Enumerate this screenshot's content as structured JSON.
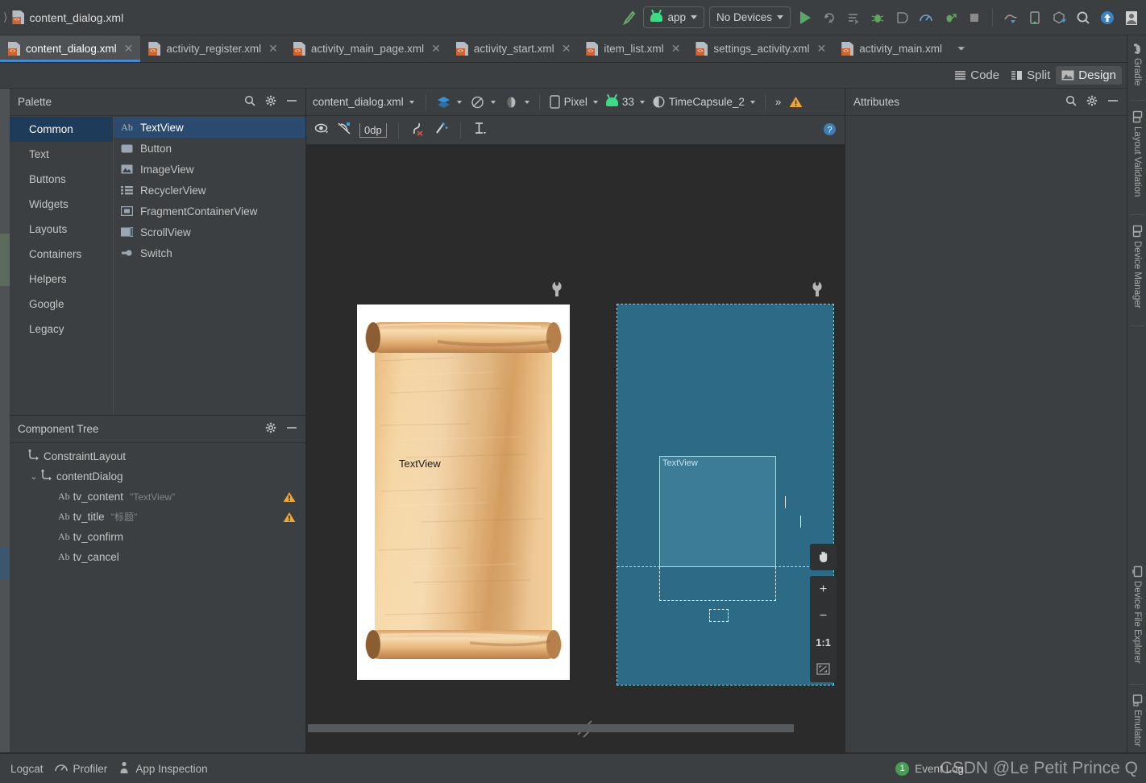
{
  "breadcrumb": {
    "file": "content_dialog.xml"
  },
  "toolbar": {
    "module_selector": "app",
    "device_selector": "No Devices",
    "icons": [
      "hammer-icon",
      "run-icon",
      "rerun-icon",
      "apply-changes-icon",
      "debug-icon",
      "attach-debugger-icon",
      "profile-icon",
      "run-coverage-icon",
      "stop-icon",
      "device-mirroring-icon",
      "device-manager-icon",
      "sdk-manager-icon",
      "search-icon",
      "update-icon",
      "avatar-icon"
    ]
  },
  "tabs": [
    {
      "label": "content_dialog.xml",
      "active": true
    },
    {
      "label": "activity_register.xml",
      "active": false
    },
    {
      "label": "activity_main_page.xml",
      "active": false
    },
    {
      "label": "activity_start.xml",
      "active": false
    },
    {
      "label": "item_list.xml",
      "active": false
    },
    {
      "label": "settings_activity.xml",
      "active": false
    },
    {
      "label": "activity_main.xml",
      "active": false
    }
  ],
  "editor_modes": [
    {
      "label": "Code",
      "icon": "code-lines-icon",
      "active": false
    },
    {
      "label": "Split",
      "icon": "split-view-icon",
      "active": false
    },
    {
      "label": "Design",
      "icon": "design-view-icon",
      "active": true
    }
  ],
  "palette": {
    "title": "Palette",
    "categories": [
      {
        "label": "Common",
        "selected": true
      },
      {
        "label": "Text",
        "selected": false
      },
      {
        "label": "Buttons",
        "selected": false
      },
      {
        "label": "Widgets",
        "selected": false
      },
      {
        "label": "Layouts",
        "selected": false
      },
      {
        "label": "Containers",
        "selected": false
      },
      {
        "label": "Helpers",
        "selected": false
      },
      {
        "label": "Google",
        "selected": false
      },
      {
        "label": "Legacy",
        "selected": false
      }
    ],
    "items": [
      {
        "label": "TextView",
        "icon": "ab-text-icon",
        "selected": true
      },
      {
        "label": "Button",
        "icon": "button-icon",
        "selected": false
      },
      {
        "label": "ImageView",
        "icon": "image-icon",
        "selected": false
      },
      {
        "label": "RecyclerView",
        "icon": "list-icon",
        "selected": false
      },
      {
        "label": "FragmentContainerView",
        "icon": "fragment-icon",
        "selected": false
      },
      {
        "label": "ScrollView",
        "icon": "scroll-icon",
        "selected": false
      },
      {
        "label": "Switch",
        "icon": "switch-icon",
        "selected": false
      }
    ]
  },
  "component_tree": {
    "title": "Component Tree",
    "nodes": [
      {
        "label": "ConstraintLayout",
        "sub": "",
        "indent": 0,
        "icon": "constraint-layout-icon",
        "twist": "",
        "warn": false
      },
      {
        "label": "contentDialog",
        "sub": "",
        "indent": 1,
        "icon": "constraint-layout-icon",
        "twist": "⌄",
        "warn": false
      },
      {
        "label": "tv_content",
        "sub": "\"TextView\"",
        "indent": 2,
        "icon": "ab-text-icon",
        "twist": "",
        "warn": true
      },
      {
        "label": "tv_title",
        "sub": "\"标题\"",
        "indent": 2,
        "icon": "ab-text-icon",
        "twist": "",
        "warn": true
      },
      {
        "label": "tv_confirm",
        "sub": "",
        "indent": 2,
        "icon": "ab-text-icon",
        "twist": "",
        "warn": false
      },
      {
        "label": "tv_cancel",
        "sub": "",
        "indent": 2,
        "icon": "ab-text-icon",
        "twist": "",
        "warn": false
      }
    ]
  },
  "design_toolbar": {
    "file_label": "content_dialog.xml",
    "view_mode_icon": "layers-icon",
    "orientation_icon": "rotate-icon",
    "theme_icon": "theme-icon",
    "device": "Pixel",
    "api_level": "33",
    "theme": "TimeCapsule_2",
    "overflow": "»",
    "warning_icon": "warning-icon"
  },
  "constraint_toolbar": {
    "margin_value": "0dp",
    "icons": [
      "view-options-icon",
      "autoconnect-off-icon",
      "default-margin-icon",
      "clear-constraints-icon",
      "infer-constraints-icon",
      "guidelines-icon",
      "help-icon"
    ]
  },
  "canvas": {
    "design_surface_label": "TextView",
    "blueprint_label": "TextView",
    "wrench_icon": "wrench-icon",
    "resize_handle_icon": "resize-handle-icon"
  },
  "zoom_controls": [
    {
      "label": "✋",
      "name": "pan-tool"
    },
    {
      "label": "+",
      "name": "zoom-in"
    },
    {
      "label": "−",
      "name": "zoom-out"
    },
    {
      "label": "1:1",
      "name": "zoom-actual"
    },
    {
      "label": "⛶",
      "name": "zoom-to-fit"
    }
  ],
  "attributes": {
    "title": "Attributes"
  },
  "right_tools": [
    {
      "label": "Gradle",
      "icon": "gradle-elephant-icon"
    },
    {
      "label": "Layout Validation",
      "icon": "layout-validation-icon"
    },
    {
      "label": "Device Manager",
      "icon": "device-manager-icon"
    },
    {
      "label": "Device File Explorer",
      "icon": "device-file-explorer-icon"
    },
    {
      "label": "Emulator",
      "icon": "emulator-icon"
    }
  ],
  "bottom_bar": {
    "items": [
      {
        "label": "Logcat",
        "icon": "logcat-icon"
      },
      {
        "label": "Profiler",
        "icon": "profiler-icon"
      },
      {
        "label": "App Inspection",
        "icon": "app-inspection-icon"
      }
    ],
    "event_log": {
      "label": "Event Log",
      "count": "1"
    },
    "watermark": "CSDN @Le Petit Prince Q"
  },
  "colors": {
    "accent_blue": "#2b4a70",
    "selection_blue": "#1e3c5a",
    "tab_underline": "#4a88c7",
    "blueprint_bg": "#2d6a85",
    "blueprint_line": "#9fdcea",
    "warning_amber": "#f0a732",
    "android_green": "#3ddc84",
    "run_green": "#59a869",
    "panel_bg": "#3c3f41",
    "canvas_bg": "#2b2b2b"
  }
}
